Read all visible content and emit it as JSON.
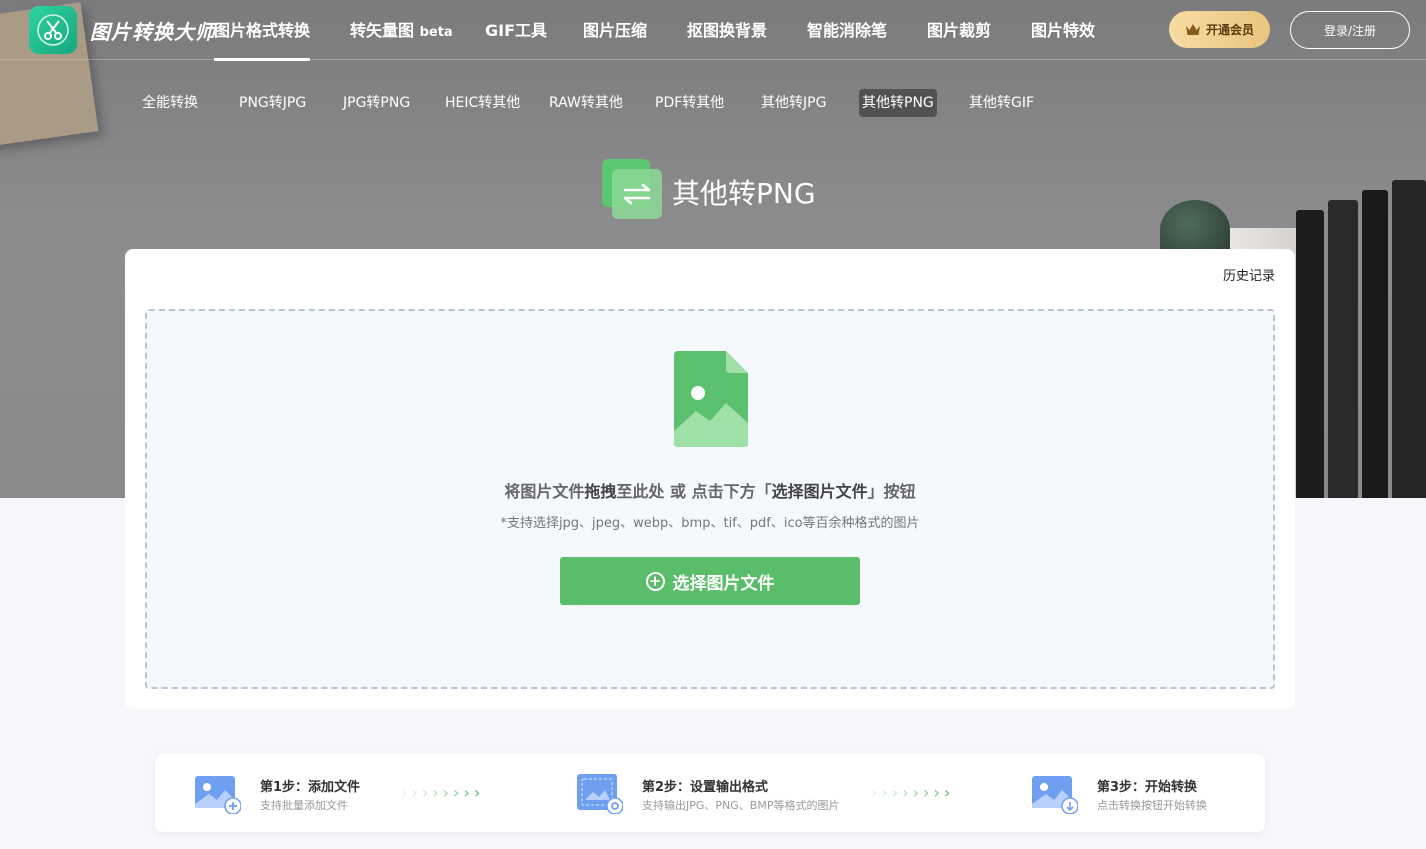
{
  "app": {
    "name": "图片转换大师"
  },
  "nav": {
    "items": [
      {
        "label": "图片格式转换"
      },
      {
        "label": "转矢量图",
        "badge": "beta"
      },
      {
        "label": "GIF工具"
      },
      {
        "label": "图片压缩"
      },
      {
        "label": "抠图换背景"
      },
      {
        "label": "智能消除笔"
      },
      {
        "label": "图片裁剪"
      },
      {
        "label": "图片特效"
      }
    ],
    "vip_label": "开通会员",
    "login_label": "登录/注册"
  },
  "subnav": {
    "items": [
      {
        "label": "全能转换"
      },
      {
        "label": "PNG转JPG"
      },
      {
        "label": "JPG转PNG"
      },
      {
        "label": "HEIC转其他"
      },
      {
        "label": "RAW转其他"
      },
      {
        "label": "PDF转其他"
      },
      {
        "label": "其他转JPG"
      },
      {
        "label": "其他转PNG"
      },
      {
        "label": "其他转GIF"
      }
    ]
  },
  "page": {
    "title": "其他转PNG"
  },
  "card": {
    "history_label": "历史记录",
    "hint": {
      "part1": "将图片文件",
      "bold1": "拖拽",
      "part2": "至此处 或 点击下方「",
      "bold2": "选择图片文件",
      "part3": "」按钮"
    },
    "sub_hint": "*支持选择jpg、jpeg、webp、bmp、tif、pdf、ico等百余种格式的图片",
    "select_button": "选择图片文件"
  },
  "steps": [
    {
      "title": "第1步：添加文件",
      "desc": "支持批量添加文件"
    },
    {
      "title": "第2步：设置输出格式",
      "desc": "支持输出JPG、PNG、BMP等格式的图片"
    },
    {
      "title": "第3步：开始转换",
      "desc": "点击转换按钮开始转换"
    }
  ],
  "colors": {
    "accent_green": "#59bd6a",
    "vip_gold": "#e9c57f",
    "logo_teal": "#1fb98b"
  }
}
